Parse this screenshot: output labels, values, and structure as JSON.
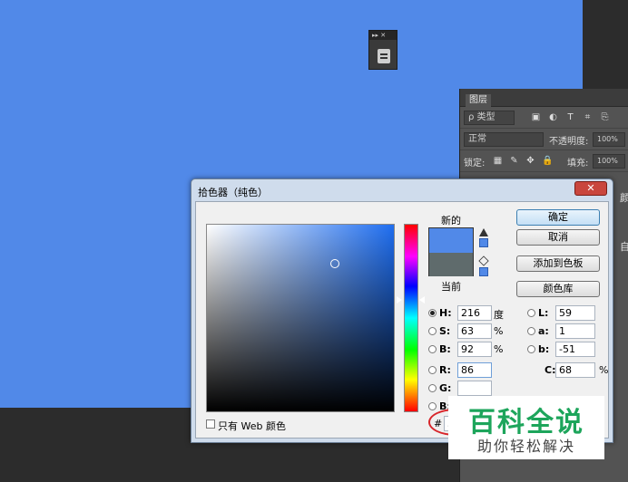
{
  "mini_panel": {
    "controls": "▸▸ ✕"
  },
  "layers_panel": {
    "tab": "图层",
    "filter_label": "ρ 类型",
    "blend_mode": "正常",
    "opacity_label": "不透明度:",
    "opacity_value": "100%",
    "lock_label": "锁定:",
    "fill_label": "填充:",
    "fill_value": "100%",
    "side_text_1": "颜",
    "side_text_2": "自"
  },
  "dialog": {
    "title": "拾色器（纯色）",
    "close_label": "✕",
    "new_label": "新的",
    "current_label": "当前",
    "buttons": {
      "ok": "确定",
      "cancel": "取消",
      "add_swatch": "添加到色板",
      "libraries": "颜色库"
    },
    "fields": {
      "H": {
        "label": "H:",
        "value": "216",
        "unit": "度"
      },
      "S": {
        "label": "S:",
        "value": "63",
        "unit": "%"
      },
      "B": {
        "label": "B:",
        "value": "92",
        "unit": "%"
      },
      "R": {
        "label": "R:",
        "value": "86"
      },
      "G": {
        "label": "G:"
      },
      "Bl": {
        "label": "B:"
      },
      "L": {
        "label": "L:",
        "value": "59"
      },
      "a": {
        "label": "a:",
        "value": "1"
      },
      "b": {
        "label": "b:",
        "value": "-51"
      },
      "C": {
        "label": "C:",
        "value": "68",
        "unit": "%"
      }
    },
    "web_only_label": "只有 Web 颜色",
    "hex_prefix": "#",
    "hex_value": "5"
  },
  "watermark": {
    "main": "百科全说",
    "sub": "助你轻松解决"
  },
  "colors": {
    "canvas": "#5189e8",
    "current": "#5f6b6c",
    "hue_pointer": "#1f6ef0"
  }
}
